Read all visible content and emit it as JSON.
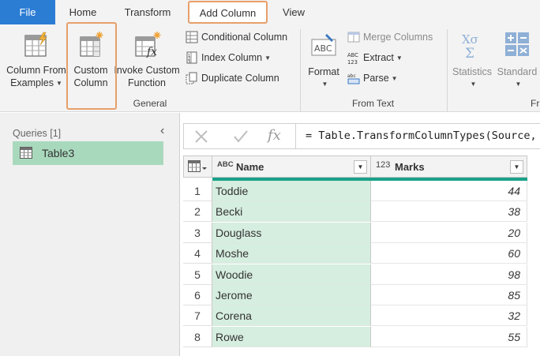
{
  "tabs": {
    "file": "File",
    "home": "Home",
    "transform": "Transform",
    "add_column": "Add Column",
    "view": "View"
  },
  "ribbon": {
    "column_from_examples": [
      "Column From",
      "Examples"
    ],
    "custom_column": [
      "Custom",
      "Column"
    ],
    "invoke_custom_function": [
      "Invoke Custom",
      "Function"
    ],
    "conditional_column": "Conditional Column",
    "index_column": "Index Column",
    "duplicate_column": "Duplicate Column",
    "general_label": "General",
    "format": "Format",
    "merge_columns": "Merge Columns",
    "extract": "Extract",
    "parse": "Parse",
    "from_text_label": "From Text",
    "statistics": "Statistics",
    "standard": "Standard",
    "from_number_label": "Fr"
  },
  "queries": {
    "header": "Queries [1]",
    "items": [
      {
        "name": "Table3"
      }
    ]
  },
  "formula_bar": {
    "formula": "= Table.TransformColumnTypes(Source,"
  },
  "table": {
    "columns": [
      {
        "type_label": "ABC",
        "name": "Name"
      },
      {
        "type_label": "123",
        "name": "Marks"
      }
    ],
    "rows": [
      {
        "num": "1",
        "name": "Toddie",
        "marks": "44"
      },
      {
        "num": "2",
        "name": "Becki",
        "marks": "38"
      },
      {
        "num": "3",
        "name": "Douglass",
        "marks": "20"
      },
      {
        "num": "4",
        "name": "Moshe",
        "marks": "60"
      },
      {
        "num": "5",
        "name": "Woodie",
        "marks": "98"
      },
      {
        "num": "6",
        "name": "Jerome",
        "marks": "85"
      },
      {
        "num": "7",
        "name": "Corena",
        "marks": "32"
      },
      {
        "num": "8",
        "name": "Rowe",
        "marks": "55"
      }
    ]
  },
  "colors": {
    "file_tab": "#2b7cd3",
    "highlight_outline": "#e79f6b",
    "selected_query": "#a9d9bd",
    "name_column_fill": "#d6eee0",
    "quality_bar": "#1aa18a"
  }
}
